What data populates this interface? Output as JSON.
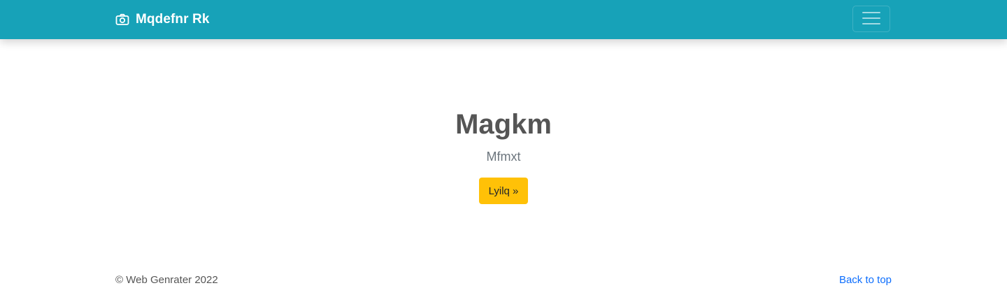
{
  "navbar": {
    "brand_icon": "camera-icon",
    "brand_text": "Mqdefnr Rk",
    "toggler_icon": "hamburger-icon",
    "background_color": "#17a2b8"
  },
  "hero": {
    "title": "Magkm",
    "subtitle": "Mfmxt",
    "button_label": "Lyilq »",
    "button_color": "#ffc107"
  },
  "footer": {
    "copyright": "© Web Genrater 2022",
    "back_to_top": "Back to top"
  }
}
